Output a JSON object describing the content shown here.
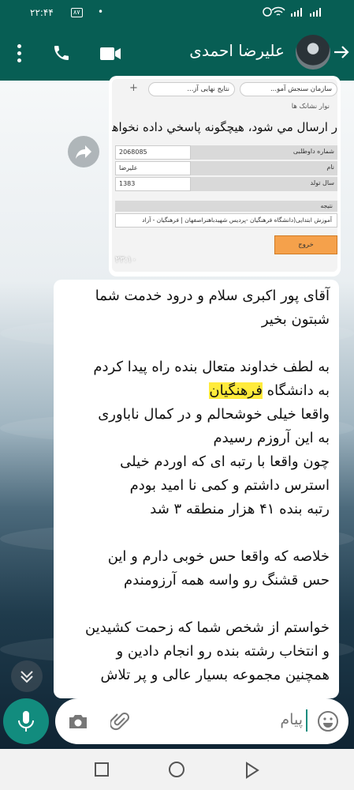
{
  "status_bar": {
    "time": "۲۲:۴۴",
    "battery": "۸۷",
    "notification_dot": "•"
  },
  "header": {
    "contact_name": "علیرضا احمدی"
  },
  "image_message": {
    "time": "۲۳:۱۰",
    "embedded_screenshot": {
      "tabs": [
        "نتایج نهایی آز...",
        "سازمان سنجش آمو..."
      ],
      "bookmarks_label": "نوار نشانک ها",
      "headline": "ر ارسال مي شود، هيچگونه پاسخي داده نخواهد",
      "fields": [
        {
          "label": "شماره داوطلبی",
          "value": "2068085"
        },
        {
          "label": "نام",
          "value": "علیرضا"
        },
        {
          "label": "سال تولد",
          "value": "1383"
        }
      ],
      "result_label": "نتیجه",
      "result_value": "آموزش ابتدایی(دانشگاه فرهنگیان -پردیس شهیدباهنراصفهان | فرهنگیان - آزاد",
      "exit_button": "خروج"
    }
  },
  "text_message": {
    "paragraphs": [
      [
        "آقای پور اکبری سلام و درود خدمت شما",
        "شبتون بخیر"
      ],
      [
        "به لطف خداوند متعال بنده راه پیدا کردم",
        "به دانشگاه |فرهنگیان|",
        "واقعا خیلی خوشحالم و در کمال ناباوری",
        "به این آروزم رسیدم",
        "چون واقعا با رتبه ای که اوردم خیلی",
        "استرس داشتم و کمی نا امید بودم",
        "رتبه بنده ۴۱ هزار منطقه ۳ شد"
      ],
      [
        "خلاصه که واقعا حس خوبی دارم و این",
        "حس قشنگ رو واسه همه آرزومندم"
      ],
      [
        "خواستم از شخص شما که زحمت کشیدین",
        "و انتخاب رشته بنده رو انجام دادین و",
        "همچنین مجموعه بسیار عالی و پر تلاش"
      ]
    ]
  },
  "input": {
    "placeholder": "پیام"
  },
  "colors": {
    "header": "#075e54",
    "accent": "#128c7e",
    "highlight": "#ffeb3b"
  }
}
